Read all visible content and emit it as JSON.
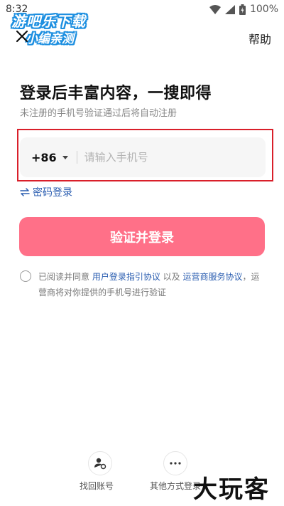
{
  "status_bar": {
    "time": "8:32",
    "battery": "100%"
  },
  "watermark": {
    "line1": "游吧乐下载",
    "line2": "小编亲测"
  },
  "header": {
    "help": "帮助"
  },
  "login": {
    "title": "登录后丰富内容，一搜即得",
    "subtitle": "未注册的手机号验证通过后将自动注册",
    "country_code": "+86",
    "phone_placeholder": "请输入手机号",
    "password_login": "密码登录",
    "submit": "验证并登录"
  },
  "agreement": {
    "prefix": "已阅读并同意 ",
    "link1": "用户登录指引协议",
    "middle": " 以及 ",
    "link2": "运营商服务协议",
    "suffix": "，运营商将对你提供的手机号进行验证"
  },
  "bottom": {
    "retrieve_account": "找回账号",
    "other_methods": "其他方式登录"
  },
  "brand_mark": "大玩客",
  "colors": {
    "accent_button": "#ff7088",
    "link": "#2a5db0",
    "highlight": "#d91f2a"
  }
}
